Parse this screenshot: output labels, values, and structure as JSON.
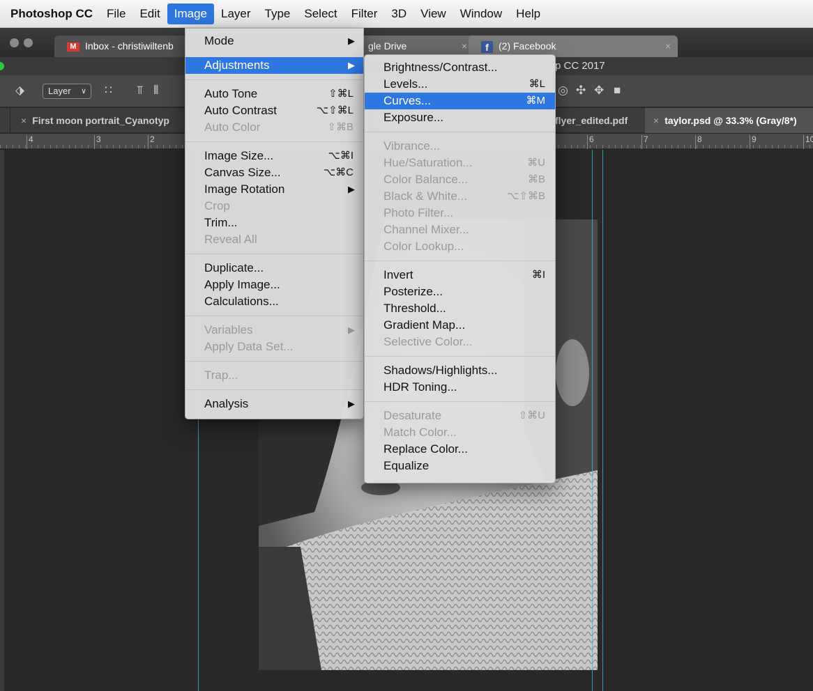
{
  "menubar": {
    "app": "Photoshop CC",
    "items": [
      "File",
      "Edit",
      "Image",
      "Layer",
      "Type",
      "Select",
      "Filter",
      "3D",
      "View",
      "Window",
      "Help"
    ]
  },
  "browser": {
    "tabs": [
      "Inbox - christiwiltenb",
      "gle Drive",
      "(2) Facebook"
    ],
    "close": "×"
  },
  "ps_title": "p CC 2017",
  "options_bar": {
    "layer_select": "Layer"
  },
  "doc_tabs": {
    "close": "×",
    "moon": "First moon portrait_Cyanotyp",
    "flyer": "flyer_edited.pdf",
    "taylor": "taylor.psd @ 33.3% (Gray/8*)"
  },
  "ruler": {
    "labels": [
      "4",
      "3",
      "2",
      "6",
      "7",
      "8",
      "9",
      "10"
    ]
  },
  "image_menu": {
    "mode": "Mode",
    "adjustments": "Adjustments",
    "auto_tone": "Auto Tone",
    "auto_tone_sc": "⇧⌘L",
    "auto_contrast": "Auto Contrast",
    "auto_contrast_sc": "⌥⇧⌘L",
    "auto_color": "Auto Color",
    "auto_color_sc": "⇧⌘B",
    "image_size": "Image Size...",
    "image_size_sc": "⌥⌘I",
    "canvas_size": "Canvas Size...",
    "canvas_size_sc": "⌥⌘C",
    "image_rotation": "Image Rotation",
    "crop": "Crop",
    "trim": "Trim...",
    "reveal_all": "Reveal All",
    "duplicate": "Duplicate...",
    "apply_image": "Apply Image...",
    "calculations": "Calculations...",
    "variables": "Variables",
    "apply_data_set": "Apply Data Set...",
    "trap": "Trap...",
    "analysis": "Analysis"
  },
  "adjustments_menu": {
    "brightness_contrast": "Brightness/Contrast...",
    "levels": "Levels...",
    "levels_sc": "⌘L",
    "curves": "Curves...",
    "curves_sc": "⌘M",
    "exposure": "Exposure...",
    "vibrance": "Vibrance...",
    "hue_saturation": "Hue/Saturation...",
    "hue_saturation_sc": "⌘U",
    "color_balance": "Color Balance...",
    "color_balance_sc": "⌘B",
    "black_white": "Black & White...",
    "black_white_sc": "⌥⇧⌘B",
    "photo_filter": "Photo Filter...",
    "channel_mixer": "Channel Mixer...",
    "color_lookup": "Color Lookup...",
    "invert": "Invert",
    "invert_sc": "⌘I",
    "posterize": "Posterize...",
    "threshold": "Threshold...",
    "gradient_map": "Gradient Map...",
    "selective_color": "Selective Color...",
    "shadows_highlights": "Shadows/Highlights...",
    "hdr_toning": "HDR Toning...",
    "desaturate": "Desaturate",
    "desaturate_sc": "⇧⌘U",
    "match_color": "Match Color...",
    "replace_color": "Replace Color...",
    "equalize": "Equalize"
  },
  "colors": {
    "highlight": "#2f77e0",
    "guide": "#38b6c4"
  }
}
